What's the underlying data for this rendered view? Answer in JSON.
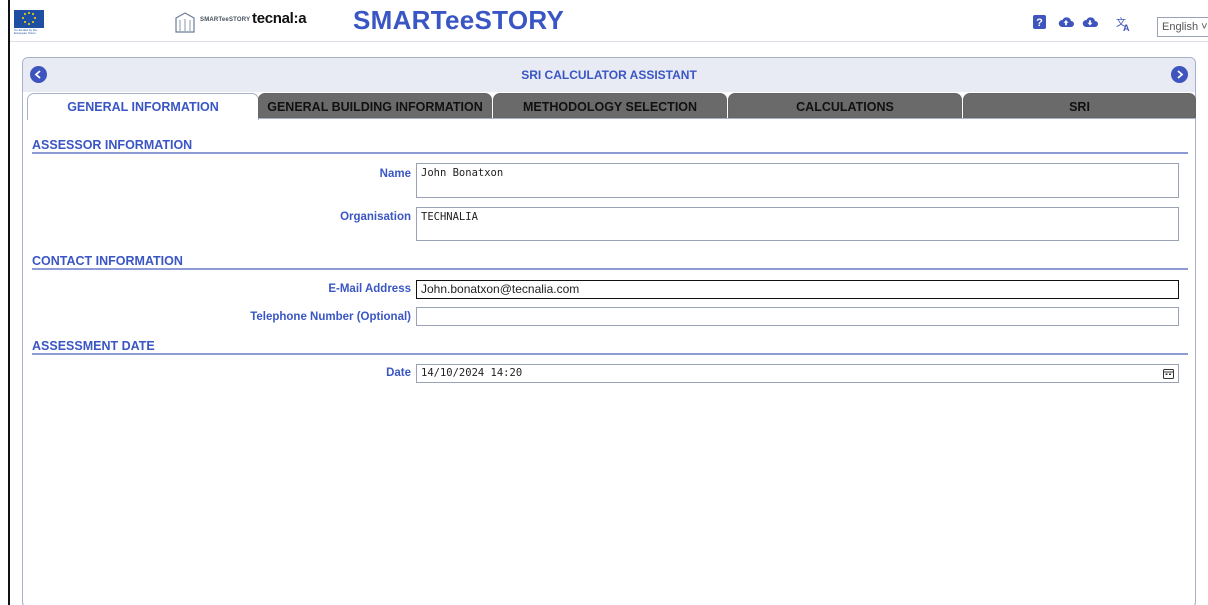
{
  "header": {
    "app_title": "SMARTeeSTORY",
    "eu_caption": "Co-funded by the European Union",
    "brand_small": "SMARTeeSTORY",
    "brand_tecnalia": "tecnal:a",
    "language": "English",
    "icons": [
      "help-icon",
      "cloud-upload-icon",
      "cloud-download-icon",
      "translate-icon"
    ]
  },
  "panel": {
    "title": "SRI CALCULATOR ASSISTANT",
    "tabs": [
      {
        "label": "GENERAL INFORMATION",
        "active": true
      },
      {
        "label": "GENERAL BUILDING INFORMATION",
        "active": false
      },
      {
        "label": "METHODOLOGY SELECTION",
        "active": false
      },
      {
        "label": "CALCULATIONS",
        "active": false
      },
      {
        "label": "SRI",
        "active": false
      }
    ]
  },
  "assessor": {
    "heading": "ASSESSOR INFORMATION",
    "name_label": "Name",
    "name_value": "John Bonatxon",
    "org_label": "Organisation",
    "org_value": "TECHNALIA"
  },
  "contact": {
    "heading": "CONTACT INFORMATION",
    "email_label": "E-Mail Address",
    "email_value": "John.bonatxon@tecnalia.com",
    "phone_label": "Telephone Number (Optional)",
    "phone_value": ""
  },
  "assessment": {
    "heading": "ASSESSMENT DATE",
    "date_label": "Date",
    "date_value": "14/10/2024 14:20"
  },
  "colors": {
    "accent": "#3a56c4",
    "tab_inactive": "#6a6a6a",
    "panel_head": "#e8ebf3"
  }
}
